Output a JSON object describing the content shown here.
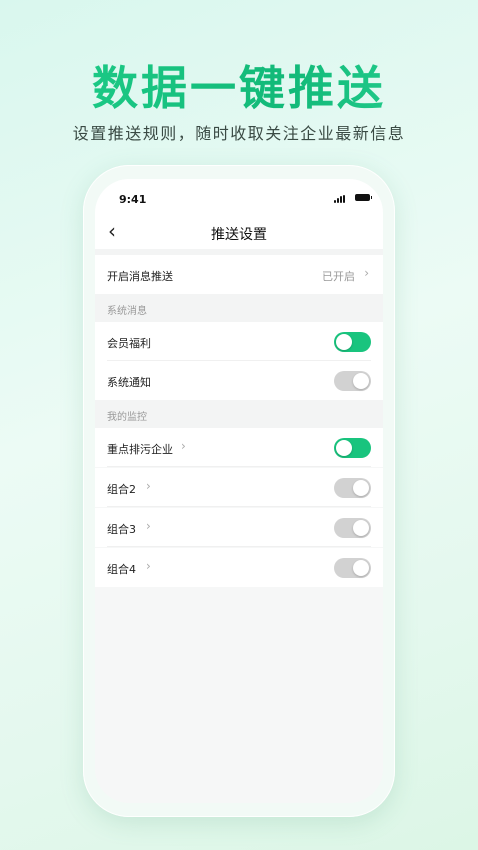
{
  "headline": "数据一键推送",
  "subline": "设置推送规则，随时收取关注企业最新信息",
  "status_bar": {
    "time": "9:41"
  },
  "nav": {
    "back_glyph": "‹",
    "title": "推送设置"
  },
  "push_row": {
    "label": "开启消息推送",
    "value": "已开启"
  },
  "sections": [
    {
      "title": "系统消息"
    },
    {
      "title": "我的监控"
    }
  ],
  "system_items": [
    {
      "label": "会员福利",
      "state": "on"
    },
    {
      "label": "系统通知",
      "state": "off"
    }
  ],
  "monitor_items": [
    {
      "label": "重点排污企业",
      "state": "on"
    },
    {
      "label": "组合2",
      "state": "off"
    },
    {
      "label": "组合3",
      "state": "off"
    },
    {
      "label": "组合4",
      "state": "off"
    }
  ],
  "chevron": "›",
  "colors": {
    "accent": "#19c47e",
    "toggle_off": "#d2d2d2"
  }
}
